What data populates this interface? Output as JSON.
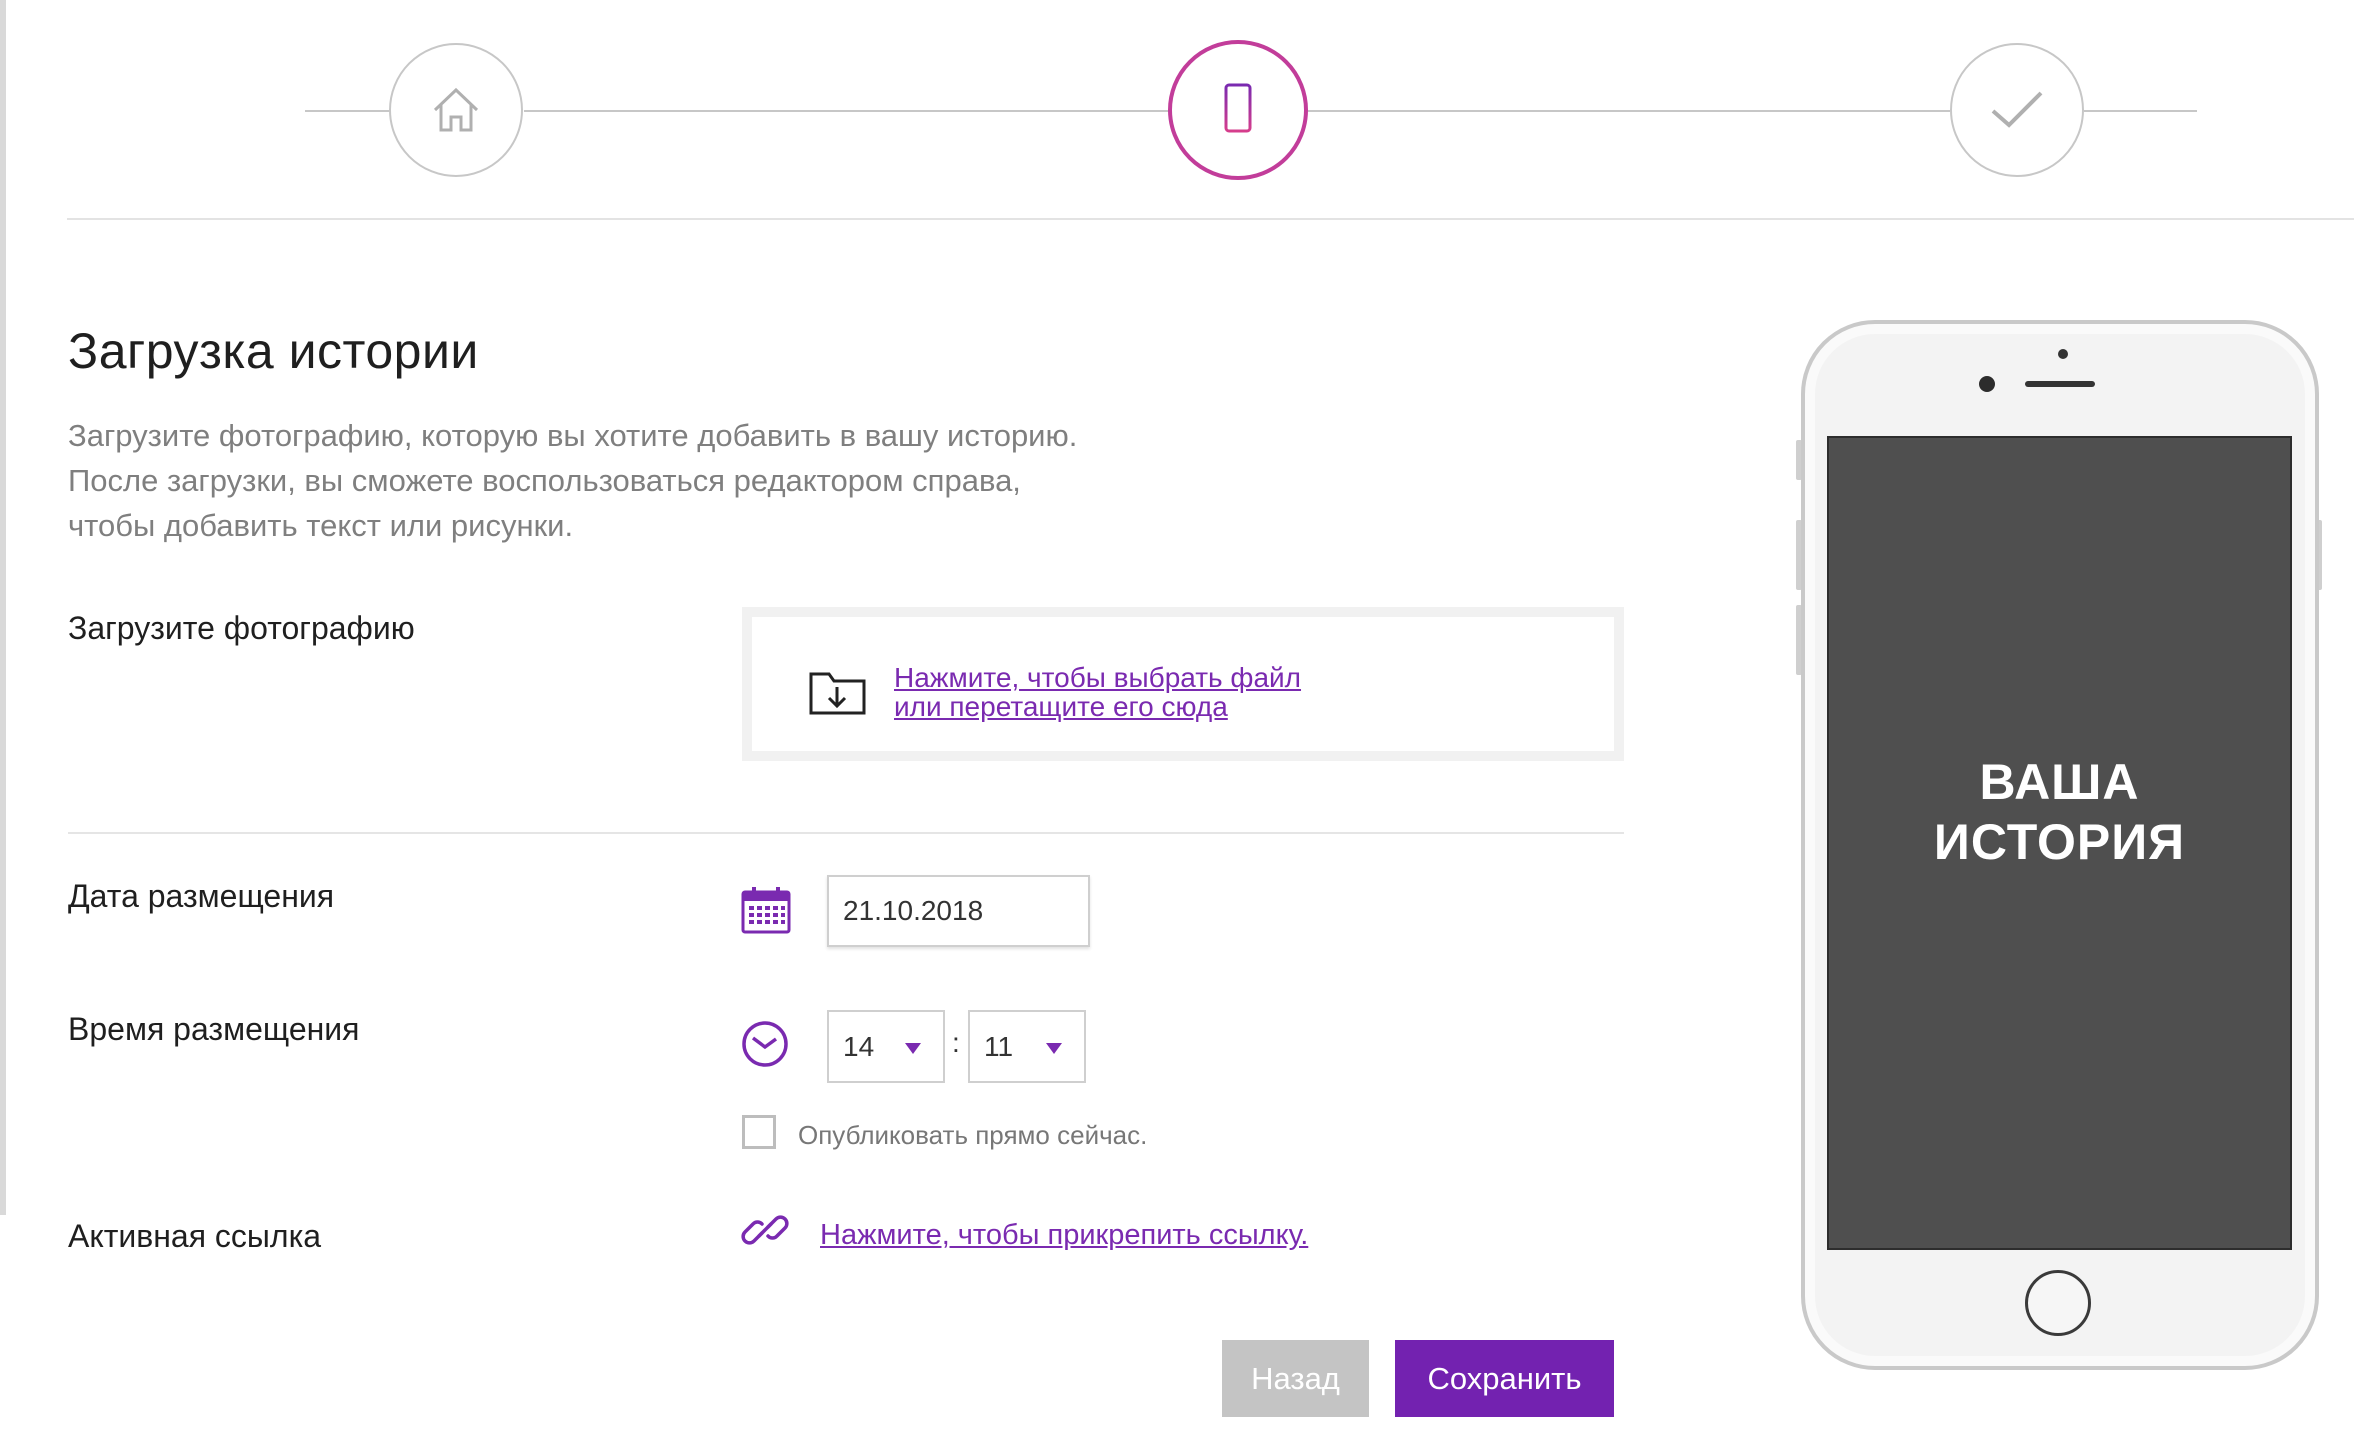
{
  "stepper": {
    "steps": [
      {
        "icon": "home-icon",
        "state": "done"
      },
      {
        "icon": "phone-icon",
        "state": "active"
      },
      {
        "icon": "checkmark-icon",
        "state": "pending"
      }
    ],
    "active_color": "#c23d9a",
    "inactive_color": "#c7c7c7"
  },
  "page": {
    "title": "Загрузка истории",
    "description": [
      "Загрузите фотографию, которую вы хотите добавить в вашу историю.",
      "После загрузки, вы сможете воспользоваться редактором справа,",
      "чтобы добавить текст или рисунки."
    ]
  },
  "upload": {
    "label": "Загрузите фотографию",
    "icon": "folder-download-icon",
    "link_lines": [
      "Нажмите, чтобы выбрать файл",
      "или перетащите его сюда"
    ]
  },
  "date": {
    "label": "Дата размещения",
    "icon": "calendar-icon",
    "value": "21.10.2018"
  },
  "time": {
    "label": "Время размещения",
    "icon": "clock-icon",
    "hour": "14",
    "minute": "11",
    "separator": ":"
  },
  "publish_now": {
    "label": "Опубликовать прямо сейчас.",
    "checked": false
  },
  "active_link": {
    "label": "Активная ссылка",
    "icon": "link-icon",
    "link_text": "Нажмите, чтобы прикрепить ссылку."
  },
  "buttons": {
    "back": "Назад",
    "save": "Сохранить"
  },
  "phone_preview": {
    "screen_text": [
      "ВАША",
      "ИСТОРИЯ"
    ]
  },
  "colors": {
    "accent": "#7322b0",
    "link": "#7a2ab0",
    "back_button": "#c4c4c4",
    "phone_screen": "#4f4f4f"
  }
}
